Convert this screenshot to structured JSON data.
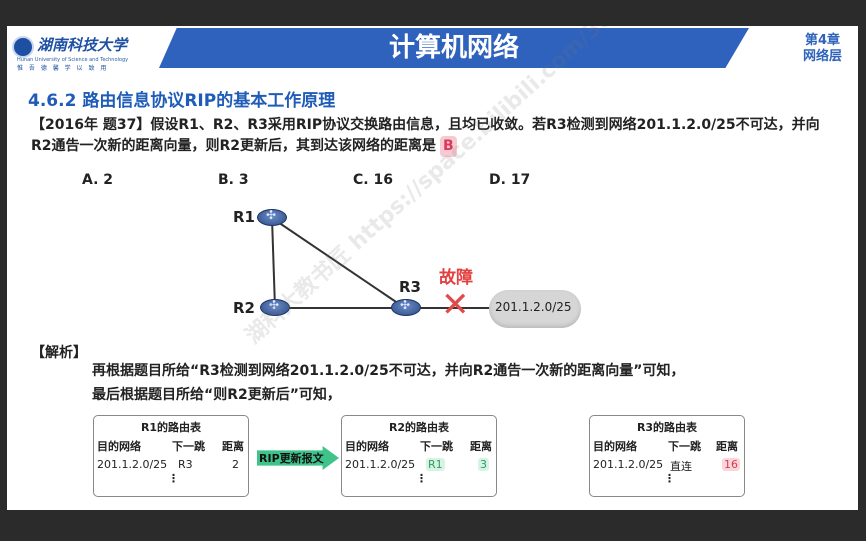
{
  "header": {
    "university_name": "湖南科技大学",
    "university_english": "Hunan University of Science and Technology",
    "motto": "惟 吾 德 馨   学 以 致 用",
    "main_title": "计算机网络",
    "chapter": "第4章",
    "chapter_name": "网络层",
    "band_color": "#2f62bc"
  },
  "section_title": "4.6.2 路由信息协议RIP的基本工作原理",
  "question": {
    "text": "【2016年 题37】假设R1、R2、R3采用RIP协议交换路由信息，且均已收敛。若R3检测到网络201.1.2.0/25不可达，并向R2通告一次新的距离向量，则R2更新后，其到达该网络的距离是",
    "answer": "B",
    "options": [
      "A. 2",
      "B. 3",
      "C. 16",
      "D. 17"
    ]
  },
  "topology": {
    "routers": [
      "R1",
      "R2",
      "R3"
    ],
    "fault_label": "故障",
    "network": "201.1.2.0/25"
  },
  "analysis": {
    "label": "【解析】",
    "line1": "再根据题目所给“R3检测到网络201.1.2.0/25不可达，并向R2通告一次新的距离向量”可知，",
    "line2": "最后根据题目所给“则R2更新后”可知，"
  },
  "tables": {
    "headers": [
      "目的网络",
      "下一跳",
      "距离"
    ],
    "r1": {
      "title": "R1的路由表",
      "dest": "201.1.2.0/25",
      "next_hop": "R3",
      "distance": "2",
      "dots": "⋮"
    },
    "r2": {
      "title": "R2的路由表",
      "dest": "201.1.2.0/25",
      "next_hop": "R1",
      "distance": "3",
      "dots": "⋮"
    },
    "r3": {
      "title": "R3的路由表",
      "dest": "201.1.2.0/25",
      "next_hop": "直连",
      "distance": "16",
      "dots": "⋮"
    }
  },
  "rip_update_label": "RIP更新报文",
  "watermark": "湖科大教书匠 https://space.bilibili.com/360996402 hnust.edu.cn"
}
